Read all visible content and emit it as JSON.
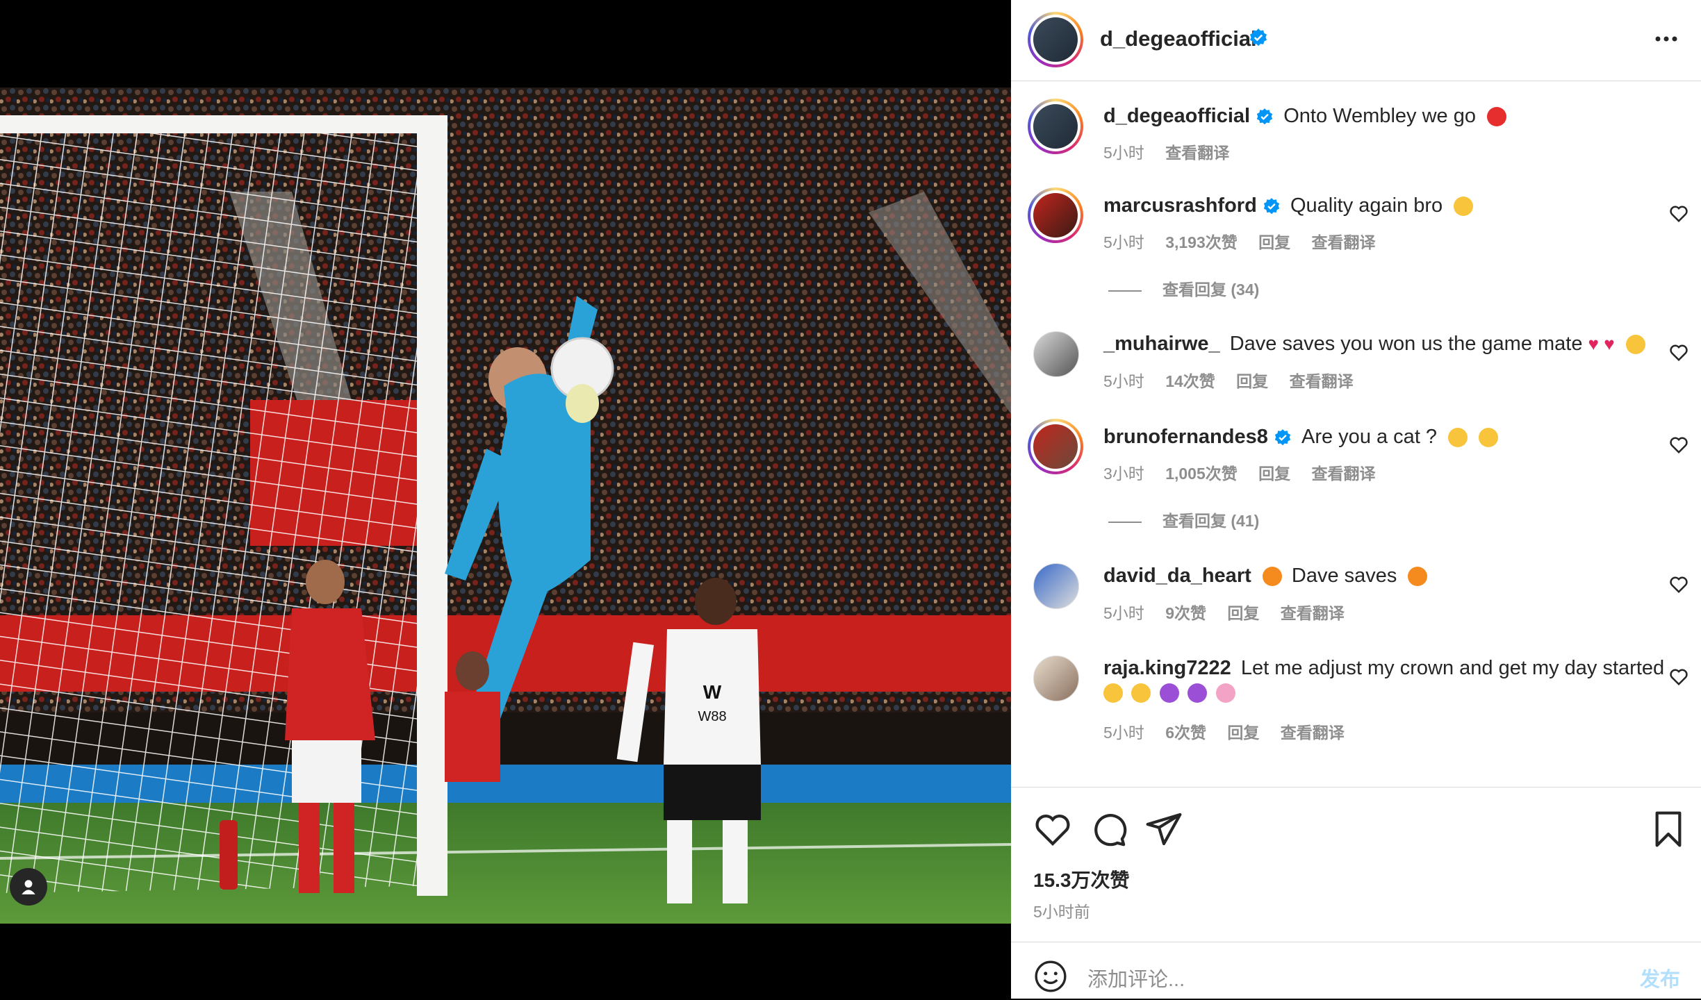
{
  "post": {
    "author": "d_degeaofficial",
    "caption_author": "d_degeaofficial",
    "caption": "Onto Wembley we go",
    "caption_time": "5小时",
    "caption_translate": "查看翻译",
    "likes": "15.3万次赞",
    "posted_ago": "5小时前"
  },
  "comments": [
    {
      "user": "marcusrashford",
      "text": "Quality again bro",
      "time": "5小时",
      "likes": "3,193次赞",
      "reply": "回复",
      "translate": "查看翻译",
      "view_replies": "查看回复 (34)",
      "verified": true
    },
    {
      "user": "_muhairwe_",
      "text": "Dave saves you won us the game mate",
      "time": "5小时",
      "likes": "14次赞",
      "reply": "回复",
      "translate": "查看翻译",
      "verified": false
    },
    {
      "user": "brunofernandes8",
      "text": "Are you a cat ?",
      "time": "3小时",
      "likes": "1,005次赞",
      "reply": "回复",
      "translate": "查看翻译",
      "view_replies": "查看回复 (41)",
      "verified": true
    },
    {
      "user": "david_da_heart",
      "text": "Dave saves",
      "time": "5小时",
      "likes": "9次赞",
      "reply": "回复",
      "translate": "查看翻译",
      "verified": false
    },
    {
      "user": "raja.king7222",
      "text": "Let me adjust my crown and get my day started",
      "time": "5小时",
      "likes": "6次赞",
      "reply": "回复",
      "translate": "查看翻译",
      "verified": false
    }
  ],
  "composer": {
    "placeholder": "添加评论...",
    "post_label": "发布"
  },
  "icons": {
    "more": "more-options-icon",
    "like": "heart-icon",
    "comment": "comment-icon",
    "share": "share-icon",
    "save": "bookmark-icon",
    "emoji": "smile-icon",
    "tag": "user-tag-icon"
  },
  "colors": {
    "verified": "#0095f6",
    "post_button": "#b2dffc",
    "secondary_text": "#8e8e8e"
  }
}
